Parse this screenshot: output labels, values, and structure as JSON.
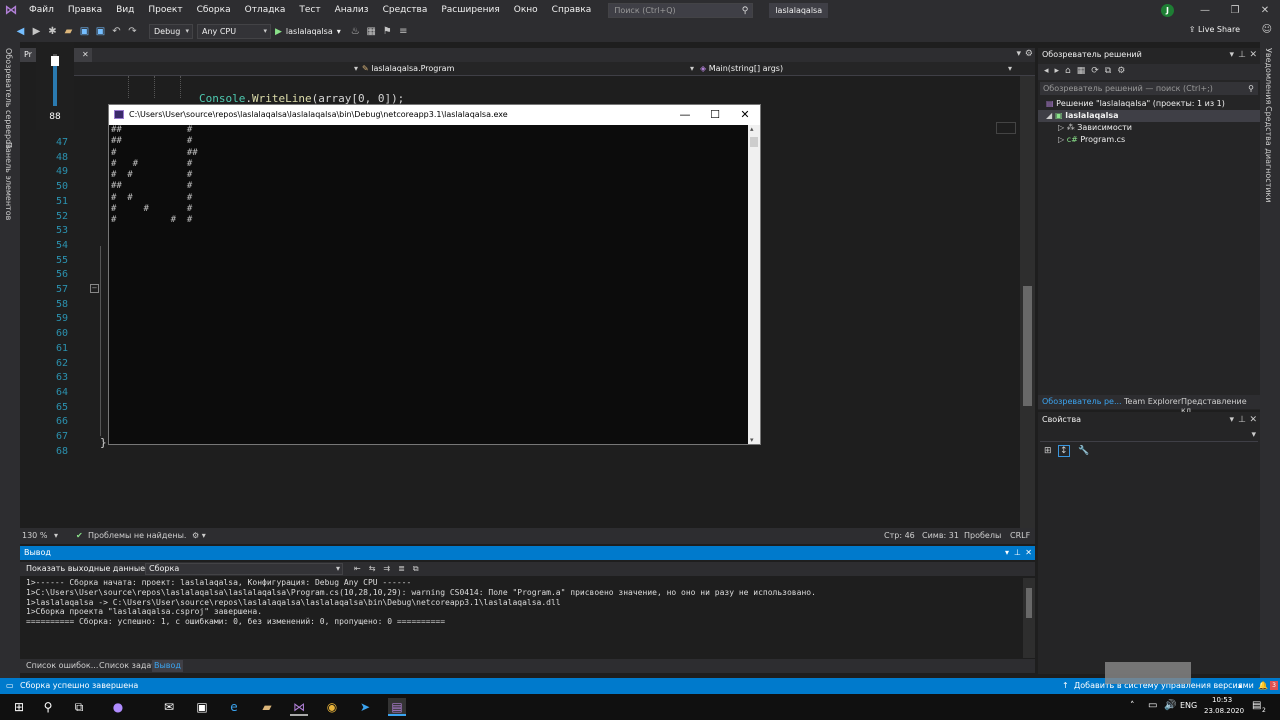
{
  "menu": [
    "Файл",
    "Правка",
    "Вид",
    "Проект",
    "Сборка",
    "Отладка",
    "Тест",
    "Анализ",
    "Средства",
    "Расширения",
    "Окно",
    "Справка"
  ],
  "search_placeholder": "Поиск (Ctrl+Q)",
  "project_title": "laslalaqalsa",
  "user_initial": "J",
  "toolbar": {
    "config": "Debug",
    "platform": "Any CPU",
    "start_target": "laslalaqalsa",
    "live_share": "Live Share"
  },
  "left_strip": [
    "Обозреватель серверов",
    "Панель элементов"
  ],
  "right_strip": [
    "Уведомления",
    "Средства диагностики"
  ],
  "editor": {
    "tab": "Pr",
    "nav_class": "laslalaqalsa.Program",
    "nav_method": "Main(string[] args)",
    "code_class": "Console",
    "code_method": "WriteLine",
    "code_args": "(array[0, 0]);",
    "line_numbers": [
      "47",
      "48",
      "49",
      "50",
      "51",
      "52",
      "53",
      "54",
      "55",
      "56",
      "57",
      "58",
      "59",
      "60",
      "61",
      "62",
      "63",
      "64",
      "65",
      "66",
      "67",
      "68"
    ]
  },
  "volume_level": 88,
  "console": {
    "title": "C:\\Users\\User\\source\\repos\\laslalaqalsa\\laslalaqalsa\\bin\\Debug\\netcoreapp3.1\\laslalaqalsa.exe",
    "lines": [
      "##            #",
      "##            #",
      "#             ##",
      "#   #         #",
      "#  #          #",
      "##            #",
      "#  #          #",
      "#     #       #",
      "#          #  #"
    ]
  },
  "solution_explorer": {
    "title": "Обозреватель решений",
    "search": "Обозреватель решений — поиск (Ctrl+;)",
    "solution": "Решение \"laslalaqalsa\" (проекты: 1 из 1)",
    "project": "laslalaqalsa",
    "deps": "Зависимости",
    "file": "Program.cs",
    "tabs": [
      "Обозреватель ре...",
      "Team Explorer",
      "Представление кл..."
    ]
  },
  "properties_title": "Свойства",
  "editor_status": {
    "zoom": "130 %",
    "problems": "Проблемы не найдены.",
    "line": "Стр: 46",
    "col": "Симв: 31",
    "spaces": "Пробелы",
    "eol": "CRLF"
  },
  "output": {
    "header": "Вывод",
    "show_from": "Показать выходные данные из:",
    "source": "Сборка",
    "lines": [
      "1>------ Сборка начата: проект: laslalaqalsa, Конфигурация: Debug Any CPU ------",
      "1>C:\\Users\\User\\source\\repos\\laslalaqalsa\\laslalaqalsa\\Program.cs(10,28,10,29): warning CS0414: Поле \"Program.a\" присвоено значение, но оно ни разу не использовано.",
      "1>laslalaqalsa -> C:\\Users\\User\\source\\repos\\laslalaqalsa\\laslalaqalsa\\bin\\Debug\\netcoreapp3.1\\laslalaqalsa.dll",
      "1>Сборка проекта \"laslalaqalsa.csproj\" завершена.",
      "========== Сборка: успешно: 1, с ошибками: 0, без изменений: 0, пропущено: 0 =========="
    ]
  },
  "bottom_tabs": [
    "Список ошибок...",
    "Список задач",
    "Вывод"
  ],
  "status_bar": {
    "message": "Сборка успешно завершена",
    "source_control": "Добавить в систему управления версиями",
    "notifications": "3"
  },
  "taskbar": {
    "lang": "ENG",
    "time": "10:53",
    "date": "23.08.2020",
    "notif_count": "2"
  },
  "colors": {
    "accent": "#007acc",
    "editor_bg": "#1e1e1e",
    "chrome": "#2d2d30"
  }
}
